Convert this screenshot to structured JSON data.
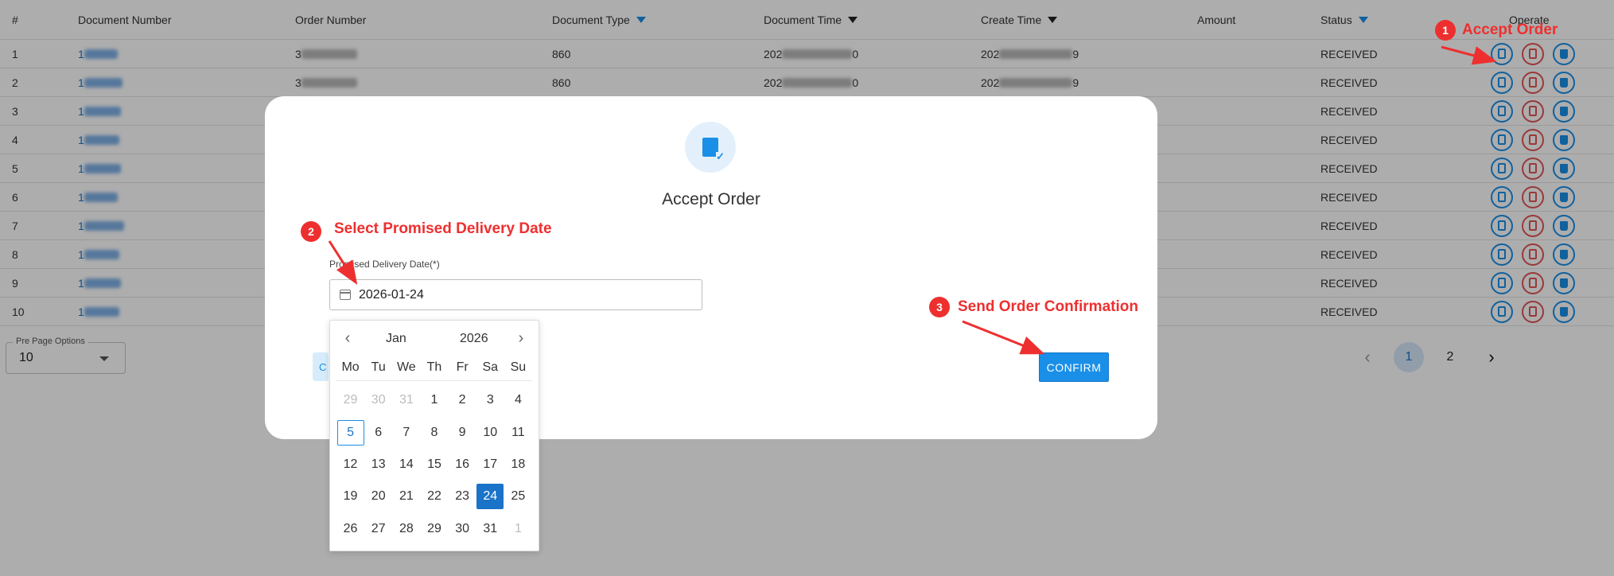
{
  "table": {
    "headers": {
      "index": "#",
      "document_number": "Document Number",
      "order_number": "Order Number",
      "document_type": "Document Type",
      "document_time": "Document Time",
      "create_time": "Create Time",
      "amount": "Amount",
      "status": "Status",
      "operate": "Operate"
    },
    "rows": [
      {
        "idx": "1",
        "doc": "1",
        "ord": "3",
        "type": "860",
        "dtime": "202",
        "dtime_end": "0",
        "ctime": "202",
        "ctime_end": "9",
        "status": "RECEIVED"
      },
      {
        "idx": "2",
        "doc": "1",
        "ord": "3",
        "type": "860",
        "dtime": "202",
        "dtime_end": "0",
        "ctime": "202",
        "ctime_end": "9",
        "status": "RECEIVED"
      },
      {
        "idx": "3",
        "doc": "1",
        "ord": "",
        "type": "",
        "dtime": "",
        "dtime_end": "",
        "ctime": "",
        "ctime_end": "",
        "status": "RECEIVED"
      },
      {
        "idx": "4",
        "doc": "1",
        "ord": "",
        "type": "",
        "dtime": "",
        "dtime_end": "",
        "ctime": "",
        "ctime_end": "",
        "status": "RECEIVED"
      },
      {
        "idx": "5",
        "doc": "1",
        "ord": "",
        "type": "",
        "dtime": "",
        "dtime_end": "",
        "ctime": "",
        "ctime_end": "",
        "status": "RECEIVED"
      },
      {
        "idx": "6",
        "doc": "1",
        "ord": "",
        "type": "",
        "dtime": "",
        "dtime_end": "",
        "ctime": "",
        "ctime_end": "",
        "status": "RECEIVED"
      },
      {
        "idx": "7",
        "doc": "1",
        "ord": "",
        "type": "",
        "dtime": "",
        "dtime_end": "",
        "ctime": "",
        "ctime_end": "",
        "status": "RECEIVED"
      },
      {
        "idx": "8",
        "doc": "1",
        "ord": "",
        "type": "",
        "dtime": "",
        "dtime_end": "",
        "ctime": "",
        "ctime_end": "",
        "status": "RECEIVED"
      },
      {
        "idx": "9",
        "doc": "1",
        "ord": "",
        "type": "",
        "dtime": "",
        "dtime_end": "",
        "ctime": "",
        "ctime_end": "",
        "status": "RECEIVED"
      },
      {
        "idx": "10",
        "doc": "1",
        "ord": "",
        "type": "",
        "dtime": "",
        "dtime_end": "",
        "ctime": "",
        "ctime_end": "",
        "status": "RECEIVED"
      }
    ],
    "row_icons": [
      "accept-icon",
      "reject-icon",
      "delete-icon"
    ]
  },
  "per_page": {
    "label": "Pre Page Options",
    "value": "10"
  },
  "pagination": {
    "prev": "‹",
    "pages": [
      "1",
      "2"
    ],
    "current": "1",
    "next": "›"
  },
  "modal": {
    "title": "Accept Order",
    "field_label": "Promised Delivery Date(*)",
    "date_value": "2026-01-24",
    "cancel_peek": "C",
    "confirm_label": "CONFIRM"
  },
  "calendar": {
    "month": "Jan",
    "year": "2026",
    "prev": "‹",
    "next": "›",
    "weekdays": [
      "Mo",
      "Tu",
      "We",
      "Th",
      "Fr",
      "Sa",
      "Su"
    ],
    "days": [
      {
        "d": "29",
        "s": "muted"
      },
      {
        "d": "30",
        "s": "muted"
      },
      {
        "d": "31",
        "s": "muted"
      },
      {
        "d": "1",
        "s": ""
      },
      {
        "d": "2",
        "s": ""
      },
      {
        "d": "3",
        "s": ""
      },
      {
        "d": "4",
        "s": ""
      },
      {
        "d": "5",
        "s": "today"
      },
      {
        "d": "6",
        "s": ""
      },
      {
        "d": "7",
        "s": ""
      },
      {
        "d": "8",
        "s": ""
      },
      {
        "d": "9",
        "s": ""
      },
      {
        "d": "10",
        "s": ""
      },
      {
        "d": "11",
        "s": ""
      },
      {
        "d": "12",
        "s": ""
      },
      {
        "d": "13",
        "s": ""
      },
      {
        "d": "14",
        "s": ""
      },
      {
        "d": "15",
        "s": ""
      },
      {
        "d": "16",
        "s": ""
      },
      {
        "d": "17",
        "s": ""
      },
      {
        "d": "18",
        "s": ""
      },
      {
        "d": "19",
        "s": ""
      },
      {
        "d": "20",
        "s": ""
      },
      {
        "d": "21",
        "s": ""
      },
      {
        "d": "22",
        "s": ""
      },
      {
        "d": "23",
        "s": ""
      },
      {
        "d": "24",
        "s": "selected"
      },
      {
        "d": "25",
        "s": ""
      },
      {
        "d": "26",
        "s": ""
      },
      {
        "d": "27",
        "s": ""
      },
      {
        "d": "28",
        "s": ""
      },
      {
        "d": "29",
        "s": ""
      },
      {
        "d": "30",
        "s": ""
      },
      {
        "d": "31",
        "s": ""
      },
      {
        "d": "1",
        "s": "muted"
      }
    ]
  },
  "annotations": [
    {
      "num": "1",
      "text": "Accept Order"
    },
    {
      "num": "2",
      "text": "Select Promised Delivery Date"
    },
    {
      "num": "3",
      "text": "Send Order Confirmation"
    }
  ],
  "colors": {
    "accent": "#1a8fe8",
    "annotation": "#ee2f2f",
    "selected_day": "#1a73c8",
    "reject": "#e25555"
  }
}
